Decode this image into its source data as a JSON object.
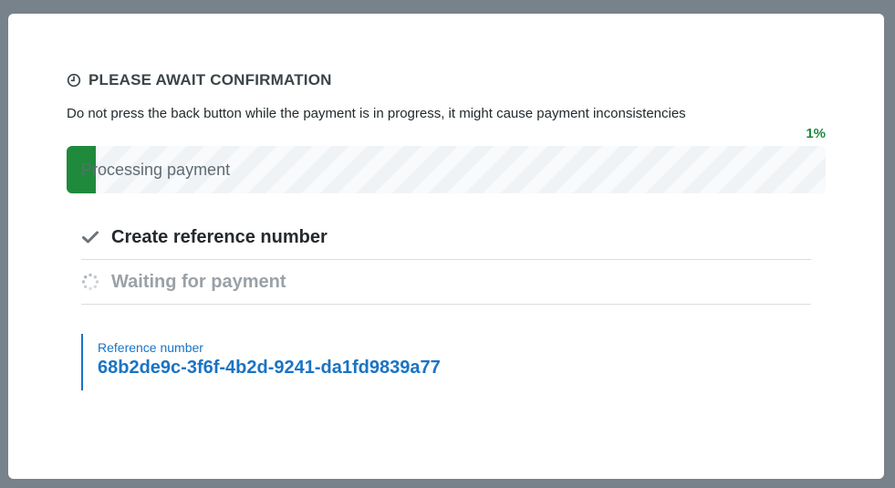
{
  "header": {
    "icon": "clock-icon",
    "title": "PLEASE AWAIT CONFIRMATION",
    "subtitle": "Do not press the back button while the payment is in progress, it might cause payment inconsistencies"
  },
  "progress": {
    "percent_text": "1%",
    "label": "Processing payment",
    "fraction": 0.038,
    "fill_color": "#1f8a3c"
  },
  "steps": [
    {
      "icon": "checkmark-icon",
      "label": "Create reference number",
      "status": "done"
    },
    {
      "icon": "spinner-icon",
      "label": "Waiting for payment",
      "status": "pending"
    }
  ],
  "reference": {
    "label": "Reference number",
    "value": "68b2de9c-3f6f-4b2d-9241-da1fd9839a77",
    "color": "#1a73c4"
  }
}
